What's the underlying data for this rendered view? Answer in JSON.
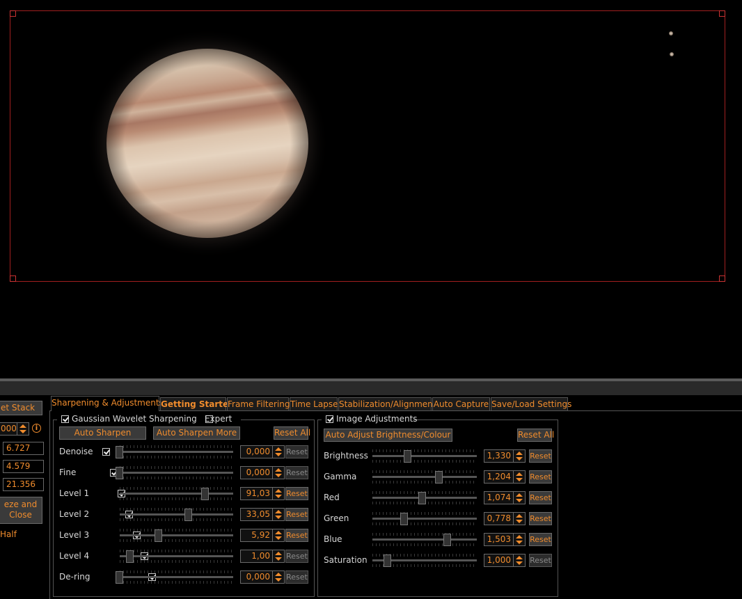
{
  "left_panel": {
    "stack_button": "et Stack",
    "spin_value": "000",
    "info_icon": "info-icon",
    "value1": "6.727",
    "value2": "4.579",
    "value3": "21.356",
    "freeze_line1": "eze and",
    "freeze_line2": "Close",
    "half_label": "Half"
  },
  "tabs": [
    {
      "label": "Sharpening & Adjustments"
    },
    {
      "label": "Getting Started"
    },
    {
      "label": "Frame Filtering"
    },
    {
      "label": "Time Lapse"
    },
    {
      "label": "Stabilization/Alignment"
    },
    {
      "label": "Auto Capture"
    },
    {
      "label": "Save/Load Settings"
    }
  ],
  "sharpening": {
    "group_label": "Gaussian Wavelet Sharpening",
    "group_checked": true,
    "expert_label": "Expert",
    "expert_checked": false,
    "auto_sharpen": "Auto Sharpen",
    "auto_sharpen_more": "Auto Sharpen More",
    "reset_all": "Reset All",
    "rows": [
      {
        "label": "Denoise",
        "checked": true,
        "value": "0,000",
        "level": 0.0,
        "reset": "Reset",
        "reset_active": false
      },
      {
        "label": "Fine",
        "checked": true,
        "value": "0,000",
        "level": 0.0,
        "reset": "Reset",
        "reset_active": false
      },
      {
        "label": "Level 1",
        "checked": true,
        "value": "91,03",
        "level": 0.81,
        "reset": "Reset",
        "reset_active": true
      },
      {
        "label": "Level 2",
        "checked": true,
        "value": "33,05",
        "level": 0.65,
        "reset": "Reset",
        "reset_active": true
      },
      {
        "label": "Level 3",
        "checked": true,
        "value": "5,92",
        "level": 0.37,
        "reset": "Reset",
        "reset_active": true
      },
      {
        "label": "Level 4",
        "checked": true,
        "value": "1,00",
        "level": 0.1,
        "reset": "Reset",
        "reset_active": false
      },
      {
        "label": "De-ring",
        "checked": true,
        "value": "0,000",
        "level": 0.0,
        "reset": "Reset",
        "reset_active": false
      }
    ]
  },
  "adjustments": {
    "group_label": "Image Adjustments",
    "group_checked": true,
    "auto_adjust": "Auto Adjust Brightness/Colour",
    "reset_all": "Reset All",
    "rows": [
      {
        "label": "Brightness",
        "value": "1,330",
        "level": 0.33,
        "reset": "Reset",
        "reset_active": true
      },
      {
        "label": "Gamma",
        "value": "1,204",
        "level": 0.63,
        "reset": "Reset",
        "reset_active": true
      },
      {
        "label": "Red",
        "value": "1,074",
        "level": 0.47,
        "reset": "Reset",
        "reset_active": true
      },
      {
        "label": "Green",
        "value": "0,778",
        "level": 0.3,
        "reset": "Reset",
        "reset_active": true
      },
      {
        "label": "Blue",
        "value": "1,503",
        "level": 0.71,
        "reset": "Reset",
        "reset_active": true
      },
      {
        "label": "Saturation",
        "value": "1,000",
        "level": 0.14,
        "reset": "Reset",
        "reset_active": false
      }
    ]
  },
  "colors": {
    "accent": "#f08c2d",
    "roi_border": "#a21f1f",
    "background": "#000000"
  }
}
